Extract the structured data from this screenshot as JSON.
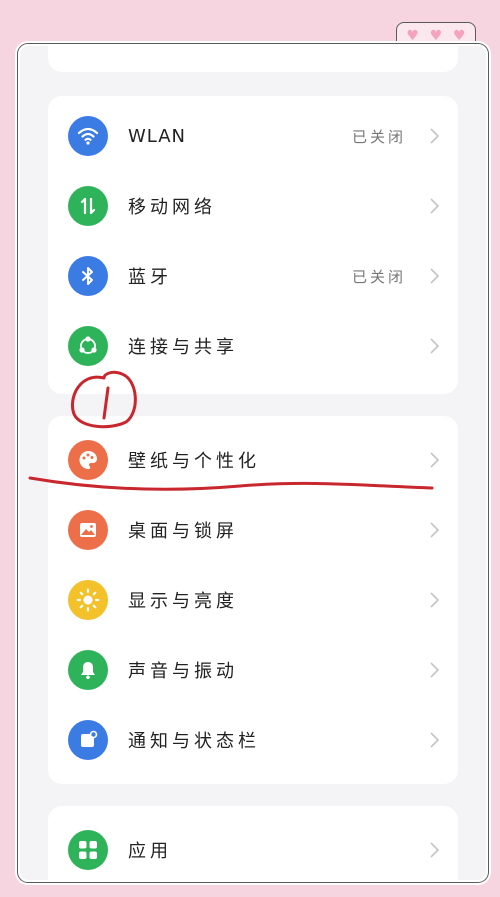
{
  "colors": {
    "blue": "#3b7be4",
    "green": "#2fb35a",
    "orange": "#ec6f49",
    "yellow": "#f3c12a",
    "annotation_red": "#c9272e"
  },
  "network_section": {
    "items": [
      {
        "label": "WLAN",
        "status": "已关闭",
        "icon": "wifi-icon"
      },
      {
        "label": "移动网络",
        "status": "",
        "icon": "mobile-data-icon"
      },
      {
        "label": "蓝牙",
        "status": "已关闭",
        "icon": "bluetooth-icon"
      },
      {
        "label": "连接与共享",
        "status": "",
        "icon": "share-icon"
      }
    ]
  },
  "display_section": {
    "items": [
      {
        "label": "壁纸与个性化",
        "icon": "palette-icon"
      },
      {
        "label": "桌面与锁屏",
        "icon": "picture-icon"
      },
      {
        "label": "显示与亮度",
        "icon": "sun-icon"
      },
      {
        "label": "声音与振动",
        "icon": "bell-icon"
      },
      {
        "label": "通知与状态栏",
        "icon": "notification-icon"
      }
    ]
  },
  "apps_section": {
    "items": [
      {
        "label": "应用",
        "icon": "apps-grid-icon"
      }
    ]
  }
}
